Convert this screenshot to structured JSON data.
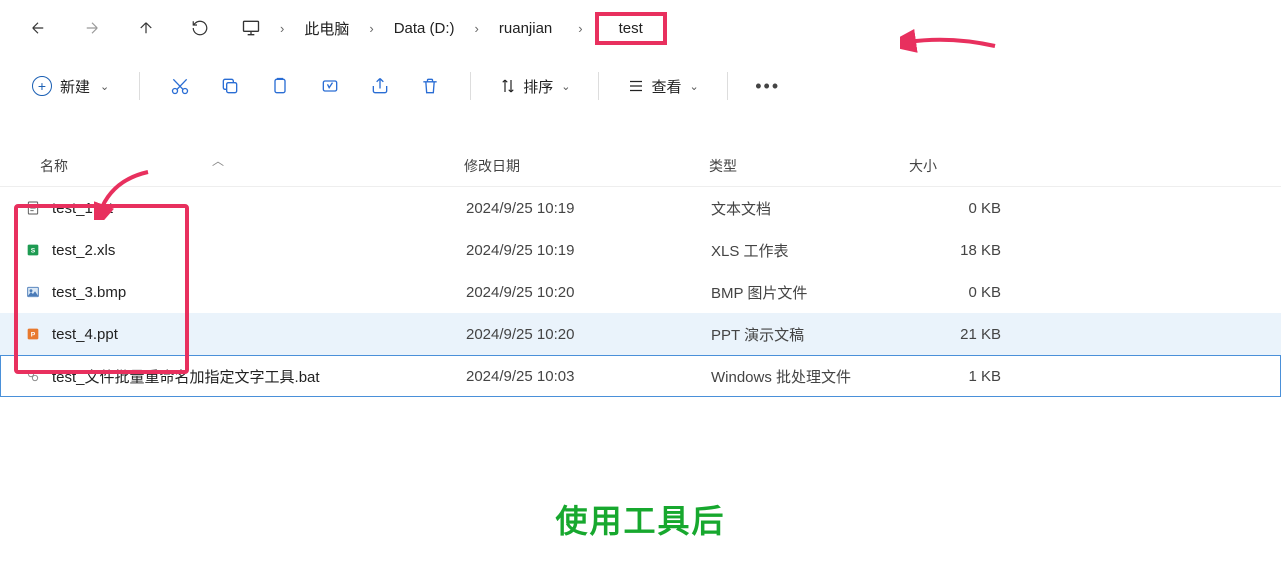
{
  "breadcrumb": {
    "items": [
      "此电脑",
      "Data (D:)",
      "ruanjian",
      "test"
    ]
  },
  "toolbar": {
    "new_label": "新建",
    "sort_label": "排序",
    "view_label": "查看"
  },
  "columns": {
    "name": "名称",
    "date": "修改日期",
    "type": "类型",
    "size": "大小"
  },
  "files": [
    {
      "name": "test_1.txt",
      "date": "2024/9/25 10:19",
      "type": "文本文档",
      "size": "0 KB",
      "icon": "txt",
      "state": ""
    },
    {
      "name": "test_2.xls",
      "date": "2024/9/25 10:19",
      "type": "XLS 工作表",
      "size": "18 KB",
      "icon": "xls",
      "state": ""
    },
    {
      "name": "test_3.bmp",
      "date": "2024/9/25 10:20",
      "type": "BMP 图片文件",
      "size": "0 KB",
      "icon": "bmp",
      "state": ""
    },
    {
      "name": "test_4.ppt",
      "date": "2024/9/25 10:20",
      "type": "PPT 演示文稿",
      "size": "21 KB",
      "icon": "ppt",
      "state": "hover"
    },
    {
      "name": "test_文件批量重命名加指定文字工具.bat",
      "date": "2024/9/25 10:03",
      "type": "Windows 批处理文件",
      "size": "1 KB",
      "icon": "bat",
      "state": "focus"
    }
  ],
  "caption": "使用工具后"
}
